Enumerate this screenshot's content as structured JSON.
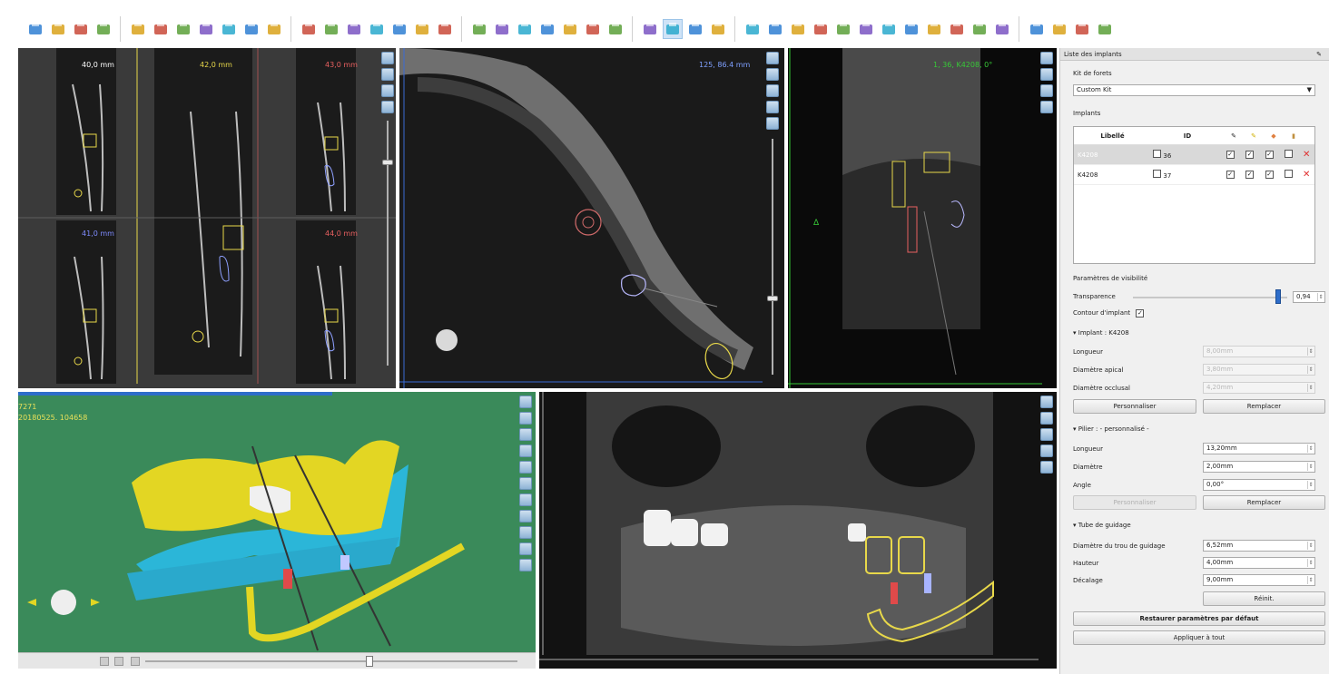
{
  "toolbar": {
    "groups": [
      [
        "open-icon",
        "import-icon",
        "save-icon",
        "close-file-icon"
      ],
      [
        "undo-icon",
        "redo-icon",
        "layout-icon",
        "panel-icon",
        "report-icon",
        "zoom-icon",
        "angle-icon"
      ],
      [
        "arch-curve-icon",
        "nerve-draw-icon",
        "implant-add-icon",
        "abutment-icon",
        "path-icon",
        "crown-icon",
        "list-icon"
      ],
      [
        "implant-view-icon",
        "implant-view2-icon",
        "ruler-icon",
        "tooth-icon",
        "sleeve-icon",
        "bone-icon",
        "density-icon"
      ],
      [
        "contrast-icon",
        "rotate-icon",
        "magnify-icon",
        "pan-icon"
      ],
      [
        "measure-icon",
        "box-icon",
        "lasso-icon",
        "pencil-icon",
        "marker-icon",
        "surface-icon",
        "surface2-icon",
        "cut-icon",
        "export-icon",
        "guide-icon",
        "tube-icon",
        "cart-icon"
      ],
      [
        "graph-icon",
        "line-tool-icon",
        "more-icon",
        "power-icon"
      ]
    ]
  },
  "views": {
    "cross_sections": [
      {
        "label": "40,0 mm",
        "color": "#ffffff"
      },
      {
        "label": "42,0 mm",
        "color": "#e8d84a"
      },
      {
        "label": "43,0 mm",
        "color": "#e86060"
      },
      {
        "label": "41,0 mm",
        "color": "#7f8cff"
      },
      {
        "label": "44,0 mm",
        "color": "#e86060"
      }
    ],
    "axial": {
      "label": "125, 86.4 mm"
    },
    "tangential": {
      "label": "1, 36, K4208, 0°"
    },
    "model3d": {
      "line1": "7271",
      "line2": "20180525. 104658"
    }
  },
  "panel": {
    "title": "Liste des implants",
    "kit_label": "Kit de forets",
    "kit_value": "Custom Kit",
    "implants_label": "Implants",
    "table": {
      "col_label": "Libellé",
      "col_id": "ID",
      "rows": [
        {
          "label": "K4208",
          "id": "36",
          "selected": true
        },
        {
          "label": "K4208",
          "id": "37",
          "selected": false
        }
      ]
    },
    "visibility_title": "Paramètres de visibilité",
    "transparency_label": "Transparence",
    "transparency_value": "0,94",
    "transparency_fraction": 0.94,
    "contour_label": "Contour d'implant",
    "implant_section": "Implant : K4208",
    "implant_fields": [
      {
        "label": "Longueur",
        "value": "8,00mm"
      },
      {
        "label": "Diamètre apical",
        "value": "3,80mm"
      },
      {
        "label": "Diamètre occlusal",
        "value": "4,20mm"
      }
    ],
    "btn_personnaliser": "Personnaliser",
    "btn_remplacer": "Remplacer",
    "pilier_section": "Pilier : - personnalisé -",
    "pilier_fields": [
      {
        "label": "Longueur",
        "value": "13,20mm"
      },
      {
        "label": "Diamètre",
        "value": "2,00mm"
      },
      {
        "label": "Angle",
        "value": "0,00°"
      }
    ],
    "guide_section": "Tube de guidage",
    "guide_fields": [
      {
        "label": "Diamètre du trou de guidage",
        "value": "6,52mm"
      },
      {
        "label": "Hauteur",
        "value": "4,00mm"
      },
      {
        "label": "Décalage",
        "value": "9,00mm"
      }
    ],
    "btn_reinit": "Réinit.",
    "btn_restore": "Restaurer paramètres par défaut",
    "btn_apply": "Appliquer à tout"
  }
}
